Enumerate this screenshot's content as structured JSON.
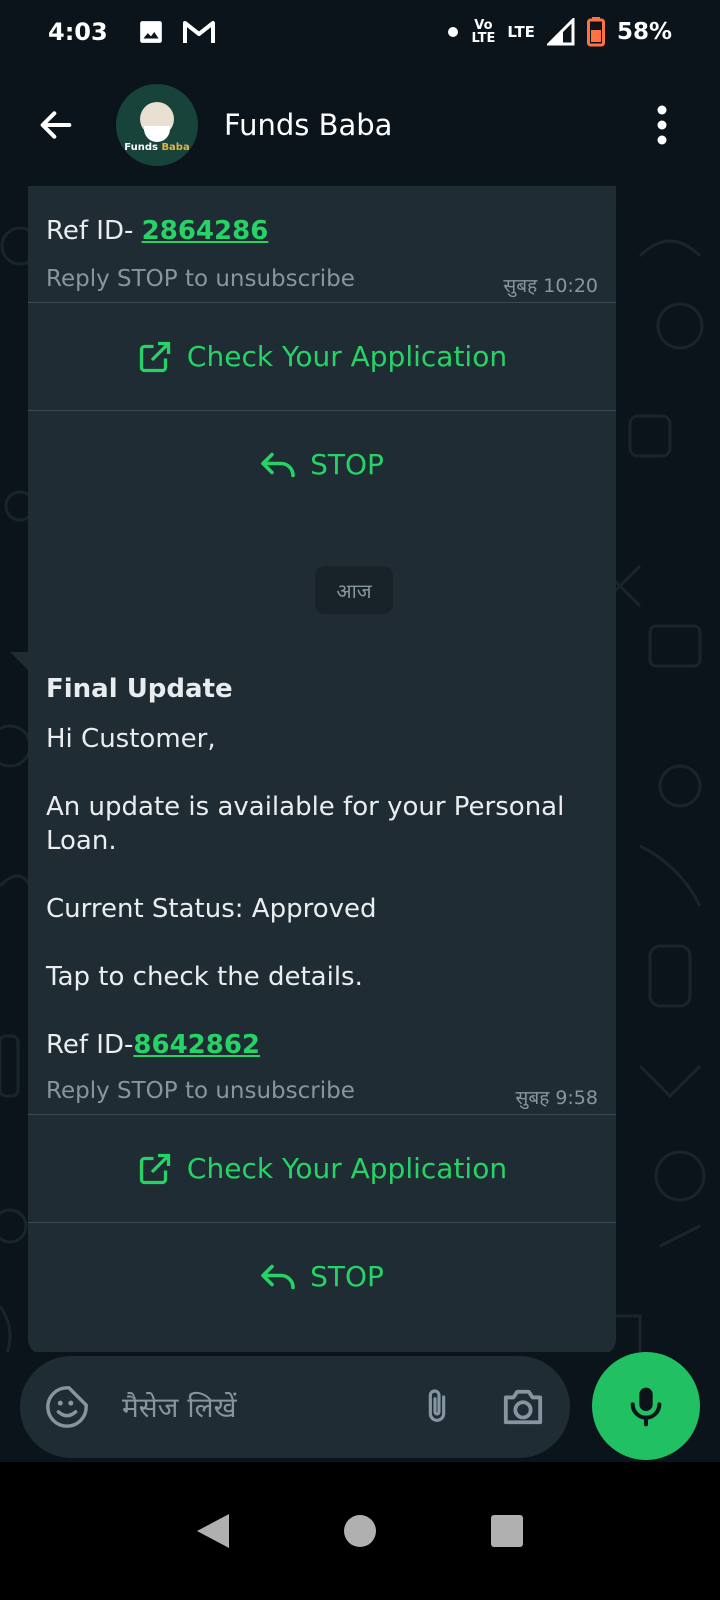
{
  "status_bar": {
    "time": "4:03",
    "volte_top": "Vo",
    "volte_bottom": "LTE",
    "lte": "LTE",
    "battery": "58%",
    "notification_icons": [
      "image-icon",
      "gmail-icon"
    ]
  },
  "header": {
    "title": "Funds Baba",
    "avatar_text_a": "Funds",
    "avatar_text_b": "Baba"
  },
  "messages": [
    {
      "ref_prefix": "Ref ID- ",
      "ref_id": "2864286",
      "reply_stop": "Reply STOP to unsubscribe",
      "time": "सुबह 10:20",
      "actions": [
        {
          "label": "Check Your Application",
          "icon": "open-external-icon"
        },
        {
          "label": "STOP",
          "icon": "reply-icon"
        }
      ]
    },
    {
      "title": "Final Update",
      "greeting": "Hi Customer,",
      "line1": "An update is available for your Personal",
      "line2": "Loan.",
      "status": "Current Status: Approved",
      "tap": "Tap to check the details.",
      "ref_prefix": "Ref ID-",
      "ref_id": "8642862",
      "reply_stop": "Reply STOP to unsubscribe",
      "time": "सुबह 9:58",
      "actions": [
        {
          "label": "Check Your Application",
          "icon": "open-external-icon"
        },
        {
          "label": "STOP",
          "icon": "reply-icon"
        }
      ]
    }
  ],
  "date_separator": "आज",
  "composer": {
    "placeholder": "मैसेज लिखें"
  },
  "colors": {
    "accent_green": "#25d366",
    "bubble": "#202c33",
    "background": "#0b141a",
    "mic": "#21c063"
  }
}
